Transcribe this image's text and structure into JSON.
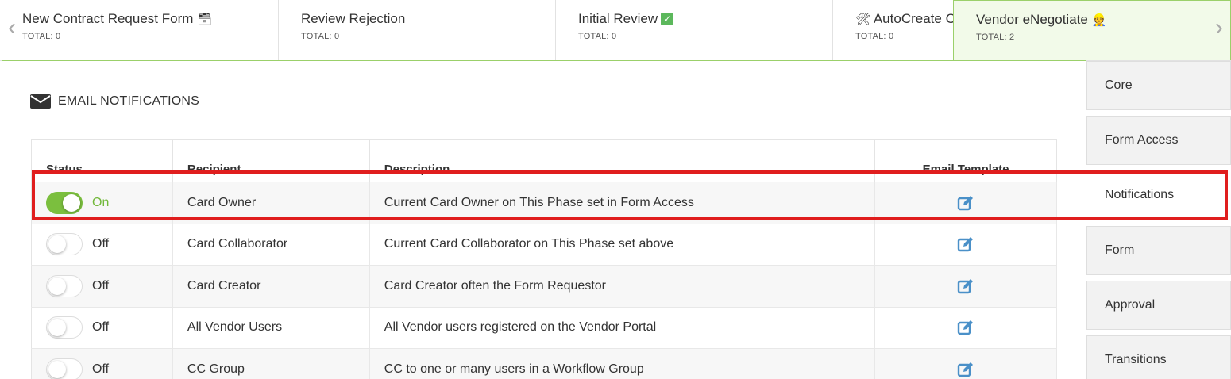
{
  "phases": [
    {
      "name": "New Contract Request Form",
      "emoji": "🗃",
      "total": "TOTAL: 0"
    },
    {
      "name": "Review Rejection",
      "emoji": "",
      "total": "TOTAL: 0"
    },
    {
      "name": "Initial Review",
      "emoji": "✓",
      "total": "TOTAL: 0"
    },
    {
      "name": "AutoCreate C",
      "emoji": "🛠",
      "total": "TOTAL: 0"
    },
    {
      "name": "Vendor eNegotiate",
      "emoji": "👷",
      "total": "TOTAL: 2"
    }
  ],
  "nav": {
    "prev": "‹",
    "next": "›"
  },
  "section": {
    "title": "EMAIL NOTIFICATIONS"
  },
  "table": {
    "headers": {
      "status": "Status",
      "recipient": "Recipient",
      "description": "Description",
      "template": "Email Template"
    },
    "rows": [
      {
        "status": "On",
        "recipient": "Card Owner",
        "description": "Current Card Owner on This Phase set in Form Access"
      },
      {
        "status": "Off",
        "recipient": "Card Collaborator",
        "description": "Current Card Collaborator on This Phase set above"
      },
      {
        "status": "Off",
        "recipient": "Card Creator",
        "description": "Card Creator often the Form Requestor"
      },
      {
        "status": "Off",
        "recipient": "All Vendor Users",
        "description": "All Vendor users registered on the Vendor Portal"
      },
      {
        "status": "Off",
        "recipient": "CC Group",
        "description": "CC to one or many users in a Workflow Group"
      }
    ]
  },
  "side_tabs": [
    "Core",
    "Form Access",
    "Notifications",
    "Form",
    "Approval",
    "Transitions"
  ],
  "colors": {
    "accent_green": "#7bbf3e",
    "active_tab_bg": "#f2fae9",
    "edit_icon": "#4a90c8",
    "highlight": "#e01e1e"
  }
}
